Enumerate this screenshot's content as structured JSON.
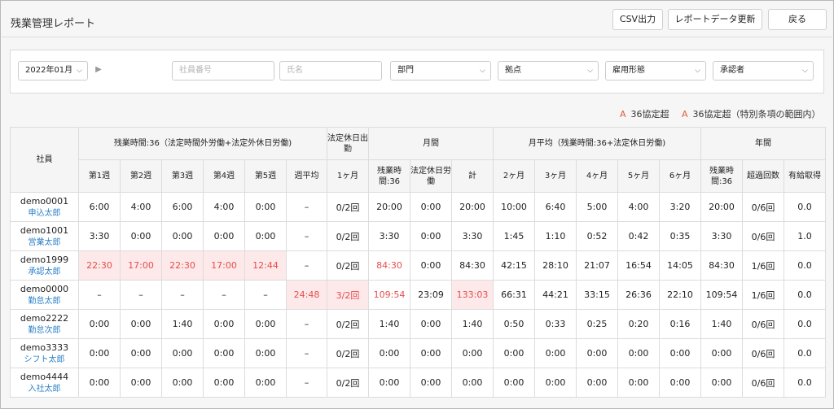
{
  "header": {
    "title": "残業管理レポート",
    "buttons": {
      "csv": "CSV出力",
      "refresh": "レポートデータ更新",
      "back": "戻る"
    }
  },
  "filters": {
    "month": "2022年01月",
    "employee_no_placeholder": "社員番号",
    "name_placeholder": "氏名",
    "department": "部門",
    "location": "拠点",
    "employment_type": "雇用形態",
    "approver": "承認者"
  },
  "legend": {
    "mark": "A",
    "item1": "36協定超",
    "item2": "36協定超（特別条項の範囲内）"
  },
  "table": {
    "groups": {
      "employee": "社員",
      "overtime36": "残業時間:36（法定時間外労働+法定外休日労働)",
      "holiday": "法定休日出勤",
      "monthly": "月間",
      "monthly_avg": "月平均（残業時間:36+法定休日労働)",
      "yearly": "年間"
    },
    "columns": [
      "第1週",
      "第2週",
      "第3週",
      "第4週",
      "第5週",
      "週平均",
      "1ヶ月",
      "残業時間:36",
      "法定休日労働",
      "計",
      "2ヶ月",
      "3ヶ月",
      "4ヶ月",
      "5ヶ月",
      "6ヶ月",
      "残業時間:36",
      "超過回数",
      "有給取得"
    ],
    "rows": [
      {
        "code": "demo0001",
        "name": "申込太郎",
        "cells": [
          "6:00",
          "4:00",
          "6:00",
          "4:00",
          "0:00",
          "–",
          "0/2回",
          "20:00",
          "0:00",
          "20:00",
          "10:00",
          "6:40",
          "5:00",
          "4:00",
          "3:20",
          "20:00",
          "0/6回",
          "0.0"
        ]
      },
      {
        "code": "demo1001",
        "name": "営業太郎",
        "cells": [
          "3:30",
          "0:00",
          "0:00",
          "0:00",
          "0:00",
          "–",
          "0/2回",
          "3:30",
          "0:00",
          "3:30",
          "1:45",
          "1:10",
          "0:52",
          "0:42",
          "0:35",
          "3:30",
          "0/6回",
          "1.0"
        ]
      },
      {
        "code": "demo1999",
        "name": "承認太郎",
        "cells": [
          "22:30",
          "17:00",
          "22:30",
          "17:00",
          "12:44",
          "–",
          "0/2回",
          "84:30",
          "0:00",
          "84:30",
          "42:15",
          "28:10",
          "21:07",
          "16:54",
          "14:05",
          "84:30",
          "1/6回",
          "0.0"
        ]
      },
      {
        "code": "demo0000",
        "name": "勤怠太郎",
        "cells": [
          "–",
          "–",
          "–",
          "–",
          "–",
          "24:48",
          "3/2回",
          "109:54",
          "23:09",
          "133:03",
          "66:31",
          "44:21",
          "33:15",
          "26:36",
          "22:10",
          "109:54",
          "1/6回",
          "0.0"
        ]
      },
      {
        "code": "demo2222",
        "name": "勤怠次郎",
        "cells": [
          "0:00",
          "0:00",
          "1:40",
          "0:00",
          "0:00",
          "–",
          "0/2回",
          "1:40",
          "0:00",
          "1:40",
          "0:50",
          "0:33",
          "0:25",
          "0:20",
          "0:16",
          "1:40",
          "0/6回",
          "0.0"
        ]
      },
      {
        "code": "demo3333",
        "name": "シフト太郎",
        "cells": [
          "0:00",
          "0:00",
          "0:00",
          "0:00",
          "0:00",
          "–",
          "0/2回",
          "0:00",
          "0:00",
          "0:00",
          "0:00",
          "0:00",
          "0:00",
          "0:00",
          "0:00",
          "0:00",
          "0/6回",
          "0.0"
        ]
      },
      {
        "code": "demo4444",
        "name": "入社太郎",
        "cells": [
          "0:00",
          "0:00",
          "0:00",
          "0:00",
          "0:00",
          "–",
          "0/2回",
          "0:00",
          "0:00",
          "0:00",
          "0:00",
          "0:00",
          "0:00",
          "0:00",
          "0:00",
          "0:00",
          "0/6回",
          "0.0"
        ]
      }
    ],
    "highlight_color": "#fde9e9",
    "warning_text_color": "#e64d4d"
  }
}
